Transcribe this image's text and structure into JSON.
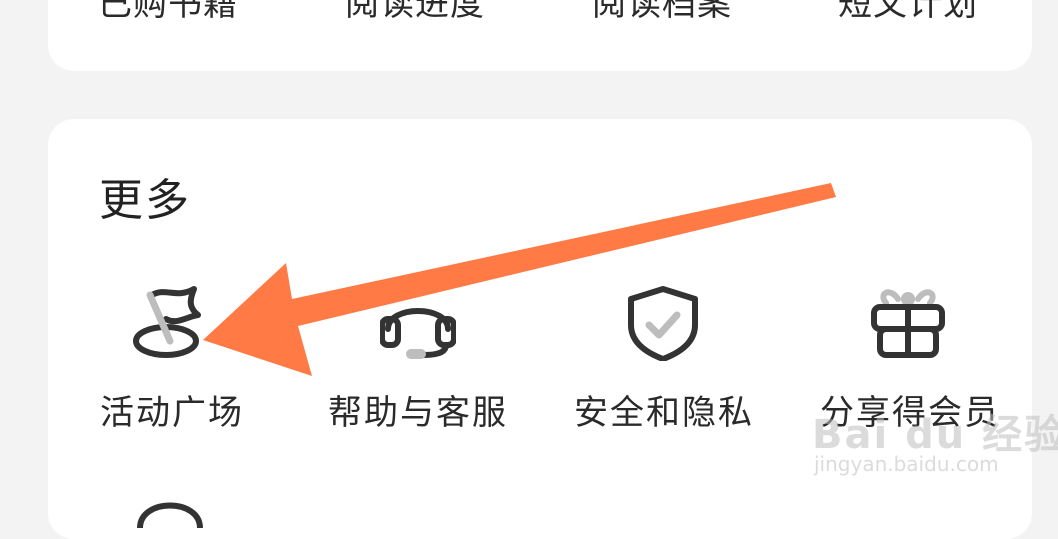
{
  "top_section": {
    "items": [
      {
        "label": "已购书籍"
      },
      {
        "label": "阅读进度"
      },
      {
        "label": "阅读档案"
      },
      {
        "label": "短文计划"
      }
    ]
  },
  "more_section": {
    "title": "更多",
    "items": [
      {
        "label": "活动广场",
        "icon": "flag-icon"
      },
      {
        "label": "帮助与客服",
        "icon": "headset-icon"
      },
      {
        "label": "安全和隐私",
        "icon": "shield-check-icon"
      },
      {
        "label": "分享得会员",
        "icon": "gift-icon"
      }
    ]
  },
  "annotation": {
    "arrow_color": "#ff7a45"
  },
  "watermark": {
    "logo": "Bai du 经验",
    "url": "jingyan.baidu.com"
  },
  "colors": {
    "background": "#f3f3f3",
    "card": "#ffffff",
    "icon_stroke": "#333333",
    "text": "#222222"
  }
}
